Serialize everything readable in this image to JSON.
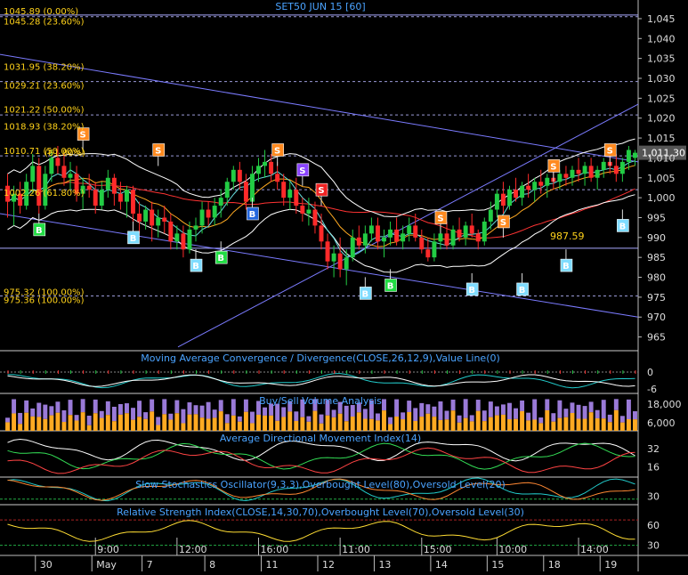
{
  "chart_data": {
    "type": "candlestick",
    "title": "SET50 JUN 15   [60]",
    "colors": {
      "up": "#22cc44",
      "down": "#ff2a2a",
      "grid": "#6a6aa0",
      "text_blue": "#4aa3ff",
      "fib_text": "#ffd21a",
      "trend": "#7b7bff",
      "sell_marker": "#ff8a1f",
      "buy_marker": "#7fdcff",
      "green_marker": "#22dd44",
      "red_marker": "#ee2222",
      "purple_marker": "#8a44ff",
      "blue_marker": "#2266dd"
    },
    "price_axis": {
      "ylim": [
        962,
        1047
      ],
      "ticks": [
        "1,045",
        "1,040",
        "1,035",
        "1,030",
        "1,025",
        "1,020",
        "1,015",
        "1,010",
        "1,005",
        "1,000",
        "995",
        "990",
        "985",
        "980",
        "975",
        "970",
        "965"
      ]
    },
    "last_price": "1,011.30",
    "annotation_value": "987.59",
    "fib_levels": [
      {
        "label": "1045.89 (0.00%)",
        "value": 1045.89
      },
      {
        "label": "1045.28 (23.60%)",
        "value": 1045.28
      },
      {
        "label": "1031.95 (38.20%)",
        "value": 1031.95
      },
      {
        "label": "1029.21 (23.60%)",
        "value": 1029.21
      },
      {
        "label": "1021.22 (50.00%)",
        "value": 1021.22
      },
      {
        "label": "1018.93 (38.20%)",
        "value": 1018.93
      },
      {
        "label": "1010.71 (50.00%)",
        "value": 1010.71
      },
      {
        "label": "(61.80%)",
        "value": 1010.3
      },
      {
        "label": "1002.26 (61.80%)",
        "value": 1002.26
      },
      {
        "label": "975.32 (100.00%)",
        "value": 975.32
      },
      {
        "label": "975.36 (100.00%)",
        "value": 975.36
      }
    ],
    "markers": [
      {
        "type": "S",
        "kind": "sell",
        "bar": 12,
        "price": 1016
      },
      {
        "type": "S",
        "kind": "sell",
        "bar": 24,
        "price": 1012
      },
      {
        "type": "S",
        "kind": "sell",
        "bar": 43,
        "price": 1012
      },
      {
        "type": "S",
        "kind": "purple",
        "bar": 47,
        "price": 1007
      },
      {
        "type": "S",
        "kind": "red",
        "bar": 50,
        "price": 1002
      },
      {
        "type": "S",
        "kind": "sell",
        "bar": 69,
        "price": 995
      },
      {
        "type": "S",
        "kind": "sell",
        "bar": 79,
        "price": 994
      },
      {
        "type": "S",
        "kind": "sell",
        "bar": 87,
        "price": 1008
      },
      {
        "type": "S",
        "kind": "sell",
        "bar": 96,
        "price": 1012
      },
      {
        "type": "B",
        "kind": "green",
        "bar": 5,
        "price": 992
      },
      {
        "type": "B",
        "kind": "buy",
        "bar": 20,
        "price": 990
      },
      {
        "type": "B",
        "kind": "buy",
        "bar": 30,
        "price": 983
      },
      {
        "type": "B",
        "kind": "green",
        "bar": 34,
        "price": 985
      },
      {
        "type": "B",
        "kind": "blue",
        "bar": 39,
        "price": 996
      },
      {
        "type": "B",
        "kind": "buy",
        "bar": 57,
        "price": 976
      },
      {
        "type": "B",
        "kind": "green",
        "bar": 61,
        "price": 978
      },
      {
        "type": "B",
        "kind": "buy",
        "bar": 74,
        "price": 977
      },
      {
        "type": "B",
        "kind": "buy",
        "bar": 82,
        "price": 977
      },
      {
        "type": "B",
        "kind": "buy",
        "bar": 89,
        "price": 983
      },
      {
        "type": "B",
        "kind": "buy",
        "bar": 98,
        "price": 993
      }
    ],
    "x_axis": {
      "time_labels": [
        {
          "label": "9:00",
          "bar": 14
        },
        {
          "label": "12:00",
          "bar": 27
        },
        {
          "label": "16:00",
          "bar": 40
        },
        {
          "label": "11:00",
          "bar": 53
        },
        {
          "label": "15:00",
          "bar": 66
        },
        {
          "label": "10:00",
          "bar": 78
        },
        {
          "label": "14:00",
          "bar": 91
        }
      ],
      "date_labels": [
        {
          "label": "30",
          "bar": 5
        },
        {
          "label": "May",
          "bar": 14
        },
        {
          "label": "7",
          "bar": 22
        },
        {
          "label": "8",
          "bar": 32
        },
        {
          "label": "11",
          "bar": 41
        },
        {
          "label": "12",
          "bar": 50
        },
        {
          "label": "13",
          "bar": 59
        },
        {
          "label": "14",
          "bar": 68
        },
        {
          "label": "15",
          "bar": 77
        },
        {
          "label": "18",
          "bar": 86
        },
        {
          "label": "19",
          "bar": 95
        }
      ]
    },
    "panels": [
      {
        "id": "macd",
        "title": "Moving Average Convergence / Divergence(CLOSE,26,12,9),Value Line(0)",
        "ticks": [
          {
            "label": "0",
            "v": 0.5
          },
          {
            "label": "-6",
            "v": 0.1
          }
        ]
      },
      {
        "id": "volume",
        "title": "Buy/Sell Volume Analysis",
        "ticks": [
          {
            "label": "18,000",
            "v": 0.72
          },
          {
            "label": "6,000",
            "v": 0.22
          }
        ]
      },
      {
        "id": "adx",
        "title": "Average Directional Movement Index(14)",
        "ticks": [
          {
            "label": "32",
            "v": 0.62
          },
          {
            "label": "16",
            "v": 0.22
          }
        ]
      },
      {
        "id": "stoch",
        "title": "Slow Stochastics Oscillator(9,3,3),Overbought Level(80),Oversold Level(20)",
        "ticks": [
          {
            "label": "30",
            "v": 0.3
          }
        ]
      },
      {
        "id": "rsi",
        "title": "Relative Strength Index(CLOSE,14,30,70),Overbought Level(70),Oversold Level(30)",
        "ticks": [
          {
            "label": "60",
            "v": 0.6
          },
          {
            "label": "30",
            "v": 0.2
          }
        ]
      }
    ],
    "candles": [
      [
        1003,
        1006,
        995,
        999
      ],
      [
        999,
        1003,
        993,
        1001
      ],
      [
        1001,
        1004,
        996,
        998
      ],
      [
        998,
        1006,
        997,
        1004
      ],
      [
        1004,
        1011,
        1001,
        1008
      ],
      [
        1008,
        1010,
        996,
        998
      ],
      [
        998,
        1008,
        997,
        1006
      ],
      [
        1006,
        1012,
        1004,
        1010
      ],
      [
        1010,
        1013,
        1006,
        1008
      ],
      [
        1008,
        1011,
        1003,
        1005
      ],
      [
        1005,
        1009,
        1002,
        1006
      ],
      [
        1006,
        1008,
        999,
        1001
      ],
      [
        1001,
        1005,
        997,
        1003
      ],
      [
        1003,
        1006,
        1000,
        1002
      ],
      [
        1002,
        1004,
        996,
        998
      ],
      [
        998,
        1004,
        997,
        1002
      ],
      [
        1002,
        1007,
        1000,
        1005
      ],
      [
        1005,
        1006,
        998,
        1001
      ],
      [
        1001,
        1004,
        997,
        999
      ],
      [
        999,
        1003,
        995,
        1002
      ],
      [
        1002,
        1003,
        993,
        996
      ],
      [
        996,
        999,
        991,
        994
      ],
      [
        994,
        998,
        992,
        997
      ],
      [
        997,
        999,
        989,
        993
      ],
      [
        993,
        997,
        990,
        995
      ],
      [
        995,
        998,
        991,
        994
      ],
      [
        994,
        996,
        987,
        989
      ],
      [
        989,
        993,
        987,
        991
      ],
      [
        991,
        993,
        985,
        987
      ],
      [
        987,
        994,
        986,
        992
      ],
      [
        992,
        995,
        989,
        993
      ],
      [
        993,
        999,
        991,
        997
      ],
      [
        997,
        999,
        993,
        995
      ],
      [
        995,
        1000,
        993,
        998
      ],
      [
        998,
        1002,
        995,
        1000
      ],
      [
        1000,
        1005,
        998,
        1004
      ],
      [
        1004,
        1008,
        1002,
        1007
      ],
      [
        1007,
        1009,
        1002,
        1004
      ],
      [
        1004,
        1006,
        997,
        999
      ],
      [
        999,
        1008,
        998,
        1006
      ],
      [
        1006,
        1010,
        1004,
        1008
      ],
      [
        1008,
        1012,
        1005,
        1009
      ],
      [
        1009,
        1011,
        1004,
        1006
      ],
      [
        1006,
        1009,
        1002,
        1004
      ],
      [
        1004,
        1006,
        998,
        1000
      ],
      [
        1000,
        1004,
        997,
        1002
      ],
      [
        1002,
        1005,
        996,
        998
      ],
      [
        998,
        1000,
        994,
        996
      ],
      [
        996,
        1000,
        993,
        997
      ],
      [
        997,
        999,
        991,
        993
      ],
      [
        993,
        996,
        987,
        989
      ],
      [
        989,
        991,
        982,
        984
      ],
      [
        984,
        988,
        980,
        986
      ],
      [
        986,
        990,
        980,
        982
      ],
      [
        982,
        987,
        978,
        985
      ],
      [
        985,
        992,
        984,
        990
      ],
      [
        990,
        993,
        987,
        988
      ],
      [
        988,
        993,
        986,
        991
      ],
      [
        991,
        995,
        989,
        993
      ],
      [
        993,
        995,
        987,
        989
      ],
      [
        989,
        992,
        985,
        990
      ],
      [
        990,
        994,
        988,
        992
      ],
      [
        992,
        995,
        988,
        989
      ],
      [
        989,
        993,
        987,
        991
      ],
      [
        991,
        995,
        989,
        993
      ],
      [
        993,
        996,
        989,
        990
      ],
      [
        990,
        992,
        986,
        987
      ],
      [
        987,
        990,
        984,
        985
      ],
      [
        985,
        991,
        984,
        989
      ],
      [
        989,
        993,
        987,
        991
      ],
      [
        991,
        994,
        987,
        988
      ],
      [
        988,
        993,
        987,
        992
      ],
      [
        992,
        995,
        989,
        990
      ],
      [
        990,
        994,
        988,
        993
      ],
      [
        993,
        996,
        990,
        991
      ],
      [
        991,
        992,
        987,
        989
      ],
      [
        989,
        995,
        988,
        994
      ],
      [
        994,
        999,
        992,
        997
      ],
      [
        997,
        1002,
        995,
        1001
      ],
      [
        1001,
        1004,
        996,
        998
      ],
      [
        998,
        1003,
        997,
        1002
      ],
      [
        1002,
        1005,
        999,
        1000
      ],
      [
        1000,
        1004,
        998,
        1003
      ],
      [
        1003,
        1006,
        1000,
        1002
      ],
      [
        1002,
        1005,
        999,
        1004
      ],
      [
        1004,
        1007,
        1001,
        1003
      ],
      [
        1003,
        1006,
        1000,
        1005
      ],
      [
        1005,
        1008,
        1002,
        1004
      ],
      [
        1004,
        1007,
        1002,
        1006
      ],
      [
        1006,
        1008,
        1003,
        1005
      ],
      [
        1005,
        1008,
        1003,
        1007
      ],
      [
        1007,
        1010,
        1004,
        1006
      ],
      [
        1006,
        1009,
        1003,
        1008
      ],
      [
        1008,
        1010,
        1004,
        1005
      ],
      [
        1005,
        1008,
        1002,
        1007
      ],
      [
        1007,
        1010,
        1005,
        1009
      ],
      [
        1009,
        1012,
        1006,
        1008
      ],
      [
        1008,
        1011,
        1004,
        1006
      ],
      [
        1006,
        1010,
        1004,
        1009
      ],
      [
        1009,
        1013,
        1007,
        1012
      ],
      [
        1010,
        1012,
        1008,
        1011.3
      ]
    ]
  }
}
